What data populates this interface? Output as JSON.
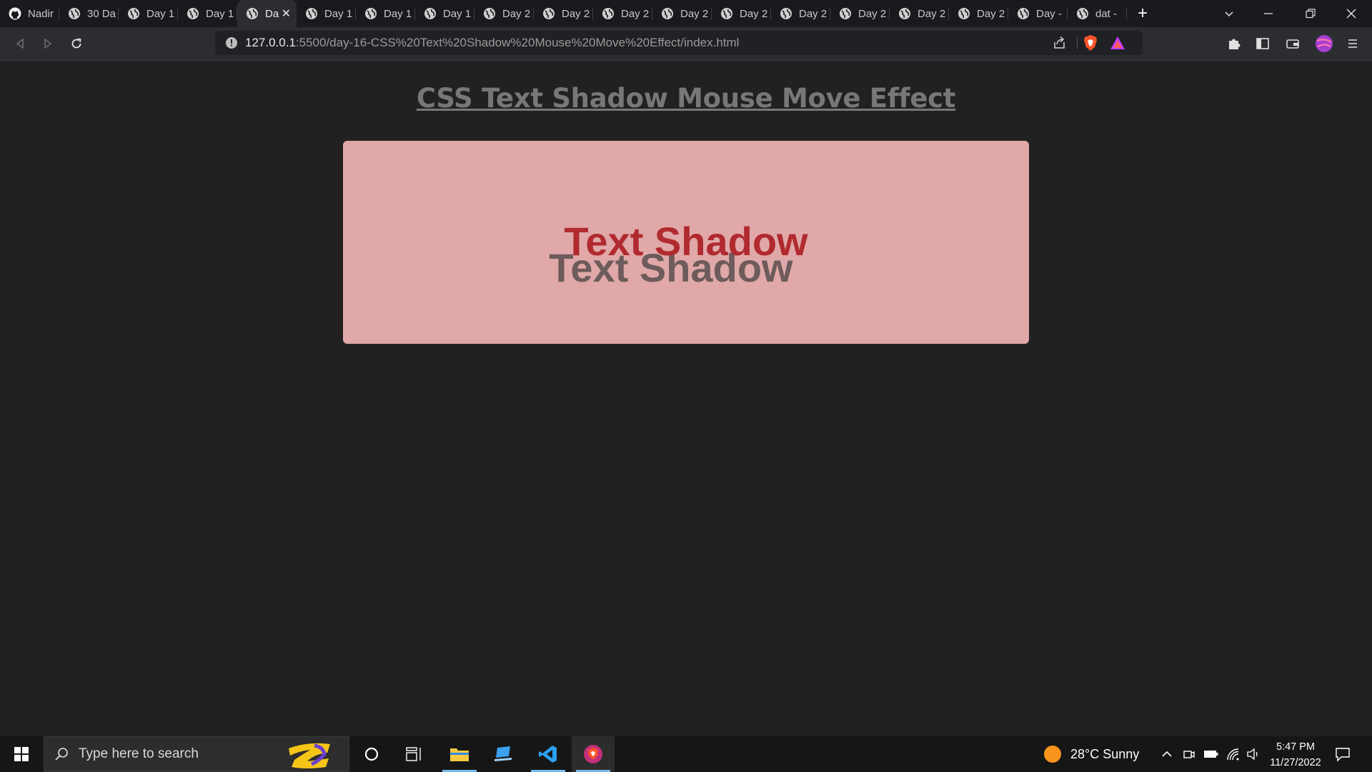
{
  "tabs": [
    {
      "title": "Nadir",
      "icon": "github-icon"
    },
    {
      "title": "30 Da",
      "icon": "globe-icon"
    },
    {
      "title": "Day 1",
      "icon": "globe-icon"
    },
    {
      "title": "Day 1",
      "icon": "globe-icon"
    },
    {
      "title": "Da",
      "icon": "globe-icon",
      "active": true
    },
    {
      "title": "Day 1",
      "icon": "globe-icon"
    },
    {
      "title": "Day 1",
      "icon": "globe-icon"
    },
    {
      "title": "Day 1",
      "icon": "globe-icon"
    },
    {
      "title": "Day 2",
      "icon": "globe-icon"
    },
    {
      "title": "Day 2",
      "icon": "globe-icon"
    },
    {
      "title": "Day 2",
      "icon": "globe-icon"
    },
    {
      "title": "Day 2",
      "icon": "globe-icon"
    },
    {
      "title": "Day 2",
      "icon": "globe-icon"
    },
    {
      "title": "Day 2",
      "icon": "globe-icon"
    },
    {
      "title": "Day 2",
      "icon": "globe-icon"
    },
    {
      "title": "Day 2",
      "icon": "globe-icon"
    },
    {
      "title": "Day 2",
      "icon": "globe-icon"
    },
    {
      "title": "Day -",
      "icon": "globe-icon"
    },
    {
      "title": "dat -",
      "icon": "globe-icon"
    }
  ],
  "address": {
    "host": "127.0.0.1",
    "path": ":5500/day-16-CSS%20Text%20Shadow%20Mouse%20Move%20Effect/index.html"
  },
  "page": {
    "heading": "CSS Text Shadow Mouse Move Effect",
    "shadow_text": "Text Shadow"
  },
  "colors": {
    "page_bg": "#212121",
    "heading": "#777777",
    "card_bg": "#e0a8a8",
    "text": "#b02a2f",
    "shadow": "#6e5b5b"
  },
  "taskbar": {
    "search_placeholder": "Type here to search",
    "weather": "28°C  Sunny",
    "time": "5:47 PM",
    "date": "11/27/2022"
  }
}
